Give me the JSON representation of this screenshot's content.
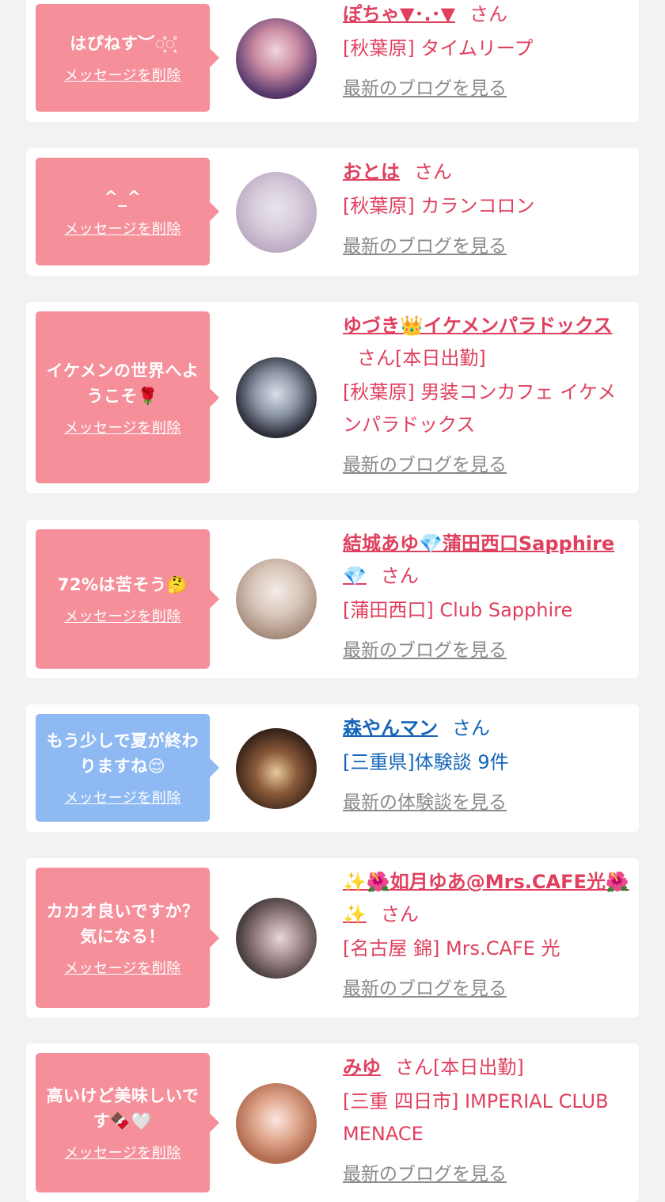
{
  "delete_label": "メッセージを削除",
  "san": "さん",
  "cards": [
    {
      "message": "はぴねす︶◌͙̊◌͙̊",
      "name": "ぽちゃ▼･.･▼",
      "suffix": "さん",
      "shop": "[秋葉原] タイムリープ",
      "link": "最新のブログを見る",
      "theme": "pink",
      "avatar_icon": "avatar-photo"
    },
    {
      "message": "^_^",
      "name": "おとは",
      "suffix": "さん",
      "shop": "[秋葉原] カランコロン",
      "link": "最新のブログを見る",
      "theme": "pink",
      "avatar_icon": "avatar-photo"
    },
    {
      "message": "イケメンの世界へようこそ🌹",
      "name": "ゆづき👑イケメンパラドックス",
      "suffix": "さん[本日出勤]",
      "shop": "[秋葉原] 男装コンカフェ イケメンパラドックス",
      "link": "最新のブログを見る",
      "theme": "pink",
      "avatar_icon": "avatar-photo"
    },
    {
      "message": "72%は苦そう🤔",
      "name": "結城あゆ💎蒲田西口Sapphire💎",
      "suffix": "さん",
      "shop": "[蒲田西口] Club Sapphire",
      "link": "最新のブログを見る",
      "theme": "pink",
      "avatar_icon": "avatar-photo"
    },
    {
      "message": "もう少しで夏が終わりますね😌",
      "name": "森やんマン",
      "suffix": "さん",
      "shop": "[三重県]体験談 9件",
      "link": "最新の体験談を見る",
      "theme": "blue",
      "avatar_icon": "avatar-photo"
    },
    {
      "message": "カカオ良いですか？気になる！",
      "name": "✨🌺如月ゆあ@Mrs.CAFE光🌺✨",
      "suffix": "さん",
      "shop": "[名古屋 錦] Mrs.CAFE 光",
      "link": "最新のブログを見る",
      "theme": "pink",
      "avatar_icon": "avatar-photo"
    },
    {
      "message": "高いけど美味しいです🍫🤍",
      "name": "みゆ",
      "suffix": "さん[本日出勤]",
      "shop": "[三重 四日市] IMPERIAL CLUB MENACE",
      "link": "最新のブログを見る",
      "theme": "pink",
      "avatar_icon": "avatar-photo"
    }
  ]
}
